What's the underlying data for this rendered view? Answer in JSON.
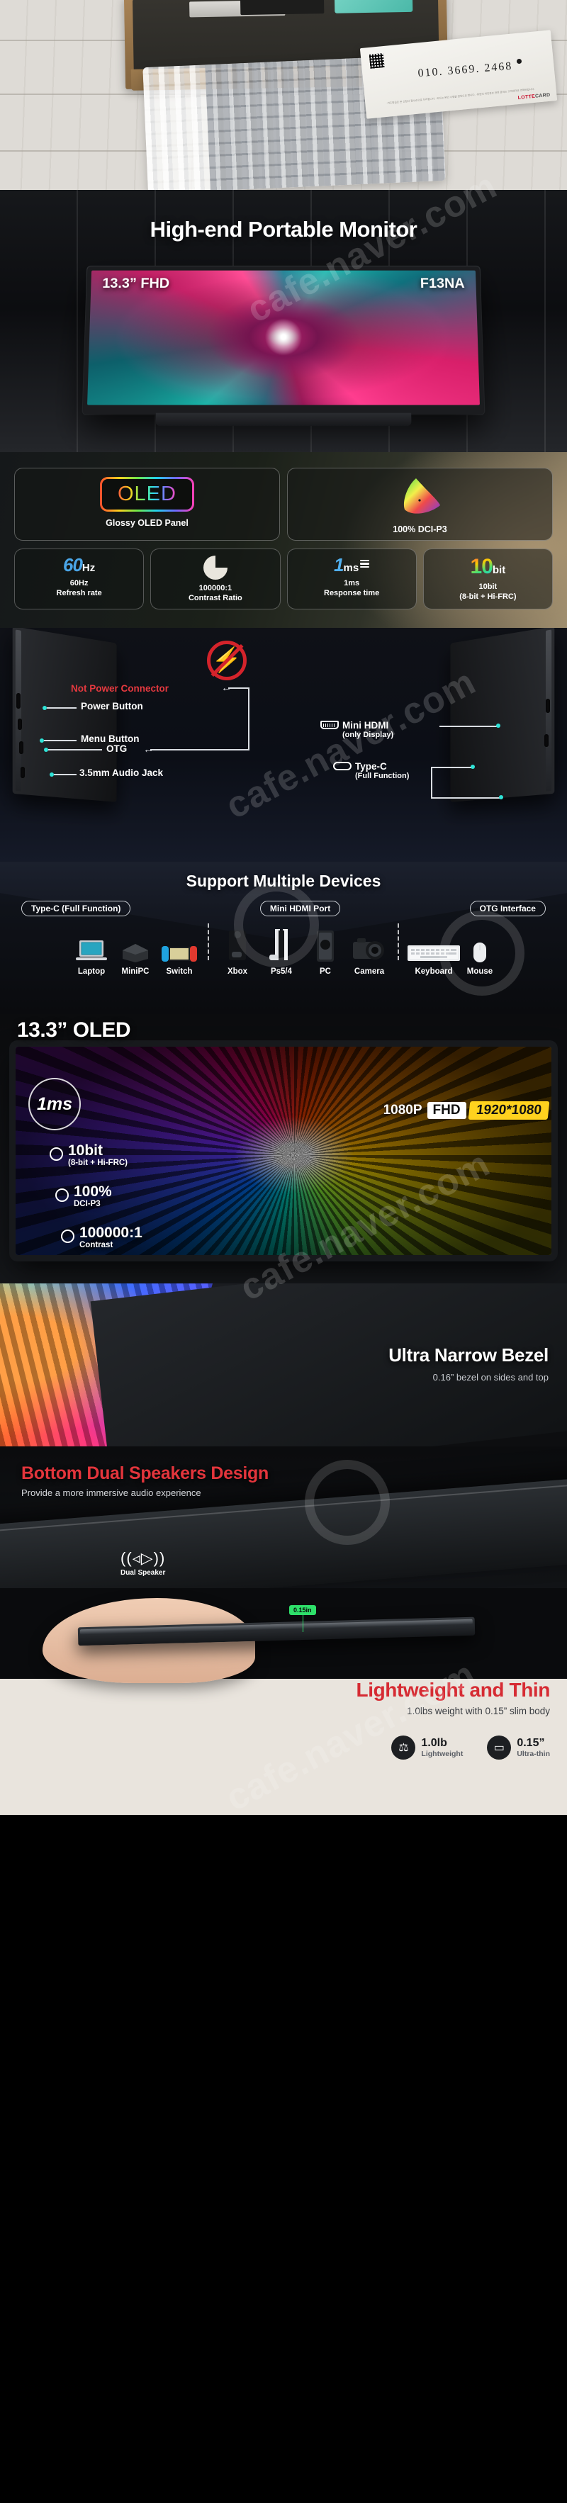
{
  "photo": {
    "handwritten_phone": "010. 3669. 2468",
    "card_brand_left": "LOTTE",
    "card_brand_right": "CARD",
    "fine_print": "·카드발급은 본 신청서 접수순으로 처리됩니다.    ·카드는 본인 수령을 원칙으로 합니다.    ·회원의 개인정보 관련 문의는 고객센터로 연락바랍니다."
  },
  "hero": {
    "title": "High-end Portable Monitor",
    "screen_label_left": "13.3” FHD",
    "screen_label_right": "F13NA"
  },
  "specs": {
    "badges": [
      {
        "icon": "oled-wordmark-icon",
        "word": "OLED",
        "caption": "Glossy OLED Panel"
      },
      {
        "icon": "color-gamut-icon",
        "caption": "100% DCI-P3"
      }
    ],
    "items": [
      {
        "icon": "refresh-rate-icon",
        "value": "60",
        "unit": "Hz",
        "cap_line1": "60Hz",
        "cap_line2": "Refresh rate"
      },
      {
        "icon": "contrast-pie-icon",
        "value": "",
        "unit": "",
        "cap_line1": "100000:1",
        "cap_line2": "Contrast Ratio"
      },
      {
        "icon": "response-time-icon",
        "value": "1",
        "unit": "ms",
        "cap_line1": "1ms",
        "cap_line2": "Response time"
      },
      {
        "icon": "color-depth-icon",
        "value": "10",
        "unit": "bit",
        "cap_line1": "10bit",
        "cap_line2": "(8-bit + Hi-FRC)"
      }
    ]
  },
  "ports": {
    "warning": "Not Power Connector",
    "left_labels": [
      "Power Button",
      "Menu Button",
      "OTG",
      "3.5mm Audio Jack"
    ],
    "hdmi_label": "Mini HDMI",
    "hdmi_sub": "(only Display)",
    "typec_label": "Type-C",
    "typec_sub": "(Full Function)"
  },
  "support": {
    "title": "Support Multiple Devices",
    "pills": [
      "Type-C (Full Function)",
      "Mini HDMI Port",
      "OTG Interface"
    ],
    "group1": [
      {
        "icon": "laptop-icon",
        "name": "Laptop"
      },
      {
        "icon": "minipc-icon",
        "name": "MiniPC"
      },
      {
        "icon": "switch-console-icon",
        "name": "Switch"
      }
    ],
    "group2": [
      {
        "icon": "xbox-console-icon",
        "name": "Xbox"
      },
      {
        "icon": "playstation-icon",
        "name": "Ps5/4"
      },
      {
        "icon": "desktop-pc-icon",
        "name": "PC"
      },
      {
        "icon": "camera-icon",
        "name": "Camera"
      }
    ],
    "group3": [
      {
        "icon": "keyboard-icon",
        "name": "Keyboard"
      },
      {
        "icon": "mouse-icon",
        "name": "Mouse"
      }
    ]
  },
  "oled_hero": {
    "title_size": "13.3”",
    "title_word": "OLED",
    "badge_1ms": "1ms",
    "bullets": [
      {
        "line1": "10bit",
        "line2": "(8-bit + Hi-FRC)"
      },
      {
        "line1": "100%",
        "line2": "DCI-P3"
      },
      {
        "line1": "100000:1",
        "line2": "Contrast"
      }
    ],
    "res_1080p": "1080P",
    "res_fhd": "FHD",
    "res_native": "1920*1080"
  },
  "bezel": {
    "heading": "Ultra Narrow Bezel",
    "subtext": "0.16” bezel on sides and top"
  },
  "speakers": {
    "heading": "Bottom Dual Speakers Design",
    "subtext": "Provide a more immersive audio experience",
    "icon": "dual-speaker-icon",
    "icon_glyph": "((◃▷))",
    "icon_label": "Dual Speaker"
  },
  "lightweight": {
    "thickness_tag": "0.15in",
    "heading": "Lightweight and Thin",
    "subtext": "1.0lbs weight with 0.15” slim body",
    "stats": [
      {
        "icon": "weight-icon",
        "glyph": "⚖",
        "value": "1.0lb",
        "caption": "Lightweight"
      },
      {
        "icon": "thickness-icon",
        "glyph": "▭",
        "value": "0.15”",
        "caption": "Ultra-thin"
      }
    ]
  },
  "watermark": {
    "text": "cafe.naver.com",
    "color": "#ffffff"
  }
}
